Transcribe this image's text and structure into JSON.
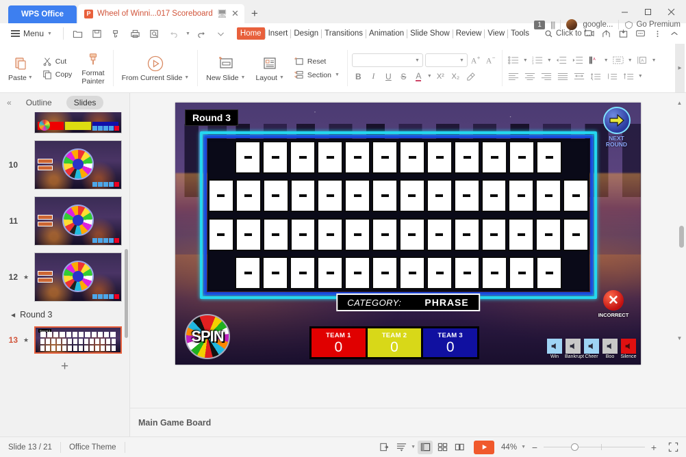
{
  "titlebar": {
    "wps_tab": "WPS Office",
    "doc_tab": "Wheel of Winni...017 Scoreboard",
    "doc_icon": "powerpoint-icon",
    "new_tab": "+",
    "minimize": "—",
    "maximize": "☐",
    "close": "✕"
  },
  "account": {
    "page_count": "1",
    "user": "google...",
    "premium": "Go Premium"
  },
  "menu": {
    "menu_label": "Menu",
    "quick": [
      "open-icon",
      "save-icon",
      "save-as-icon",
      "print-icon",
      "print-preview-icon",
      "undo-icon",
      "redo-icon",
      "customize-icon"
    ],
    "tabs": [
      {
        "label": "Home",
        "active": true
      },
      {
        "label": "Insert",
        "active": false
      },
      {
        "label": "Design",
        "active": false
      },
      {
        "label": "Transitions",
        "active": false
      },
      {
        "label": "Animation",
        "active": false
      },
      {
        "label": "Slide Show",
        "active": false
      },
      {
        "label": "Review",
        "active": false
      },
      {
        "label": "View",
        "active": false
      },
      {
        "label": "Tools",
        "active": false
      }
    ],
    "find_label": "Click to f...",
    "right_icons": [
      "present-icon",
      "share-icon",
      "export-icon",
      "comment-icon",
      "more-icon",
      "collapse-ribbon-icon"
    ]
  },
  "ribbon": {
    "paste": "Paste",
    "cut": "Cut",
    "copy": "Copy",
    "format_painter_1": "Format",
    "format_painter_2": "Painter",
    "from_current_slide": "From Current Slide",
    "new_slide": "New Slide",
    "layout": "Layout",
    "reset": "Reset",
    "section": "Section",
    "font_name": "",
    "font_size": "",
    "grow_font": "A",
    "shrink_font": "A",
    "bold": "B",
    "italic": "I",
    "underline": "U",
    "strikethrough": "S",
    "font_color": "A",
    "superscript": "X²",
    "subscript": "X₂",
    "clear_format": "clear-format-icon"
  },
  "sidebar": {
    "collapse": "«",
    "outline_tab": "Outline",
    "slides_tab": "Slides",
    "slides": [
      {
        "num": "",
        "type": "board",
        "selected": false,
        "partial": true
      },
      {
        "num": "10",
        "type": "wheel",
        "selected": false,
        "star": false
      },
      {
        "num": "11",
        "type": "wheel",
        "selected": false,
        "star": false
      },
      {
        "num": "12",
        "type": "wheel",
        "selected": false,
        "star": true
      },
      {
        "num": "13",
        "type": "board",
        "selected": true,
        "star": true
      }
    ],
    "section_label": "Round 3",
    "add_slide": "+"
  },
  "slide": {
    "round_label": "Round 3",
    "next_round_line1": "NEXT",
    "next_round_line2": "ROUND",
    "next_round_icon": "arrow-right-icon",
    "category_label": "CATEGORY:",
    "category_value": "PHRASE",
    "spin_label": "SPIN",
    "incorrect_label": "INCORRECT",
    "incorrect_icon": "x-circle-icon",
    "grid_rows": [
      12,
      14,
      14,
      12
    ],
    "teams": [
      {
        "name": "TEAM 1",
        "score": "0",
        "color": "#e00000"
      },
      {
        "name": "TEAM 2",
        "score": "0",
        "color": "#d8d818"
      },
      {
        "name": "TEAM 3",
        "score": "0",
        "color": "#1010a0"
      }
    ],
    "sounds": [
      {
        "label": "Win",
        "color": "#9fd4f5"
      },
      {
        "label": "Bankrupt",
        "color": "#c8c8c8"
      },
      {
        "label": "Cheer",
        "color": "#9fd4f5"
      },
      {
        "label": "Boo",
        "color": "#c8c8c8"
      },
      {
        "label": "Silence",
        "color": "#e01010"
      }
    ]
  },
  "notes": {
    "text": "Main Game Board"
  },
  "status": {
    "slide_counter": "Slide 13 / 21",
    "theme": "Office Theme",
    "zoom": "44%",
    "views": [
      "fit-slide-icon",
      "outline-view-icon",
      "normal-view-icon",
      "slide-sorter-icon",
      "reading-view-icon"
    ],
    "play": "play-icon",
    "zoom_out": "−",
    "zoom_in": "+",
    "fit_window": "fit-window-icon"
  },
  "colors": {
    "accent": "#e8603c",
    "tab_blue": "#3d7ff0",
    "neon_cyan": "#24d6f0",
    "neon_blue": "#1a3fd8"
  }
}
